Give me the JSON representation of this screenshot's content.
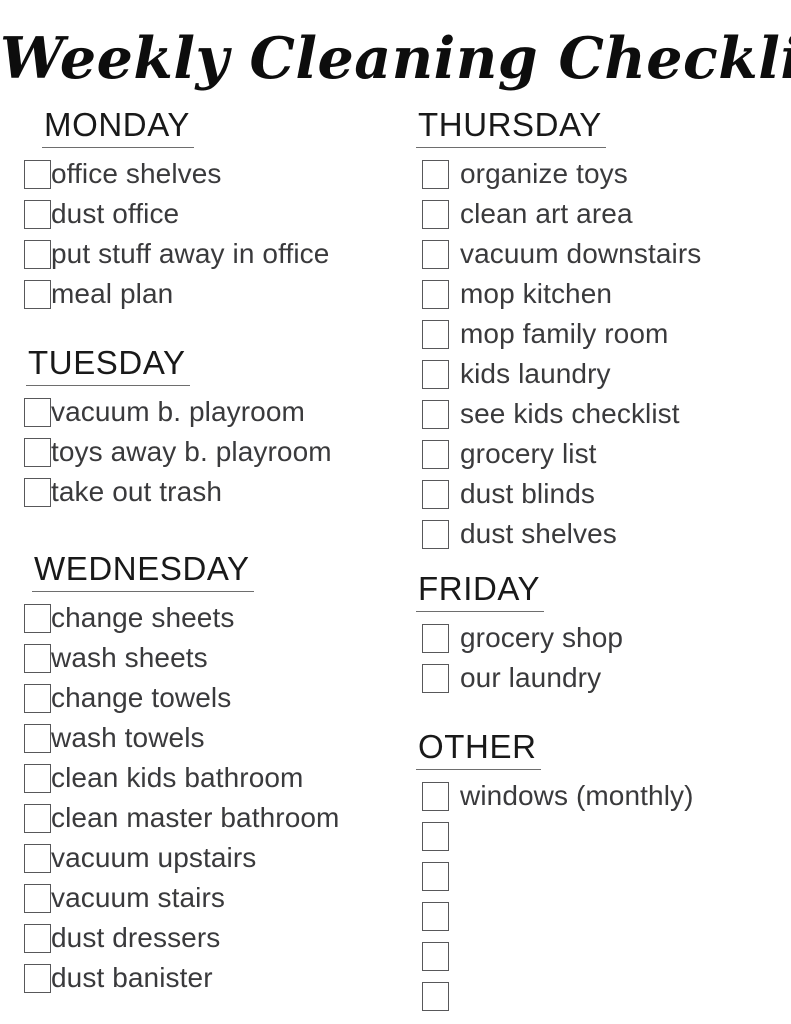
{
  "document": {
    "title": "Weekly Cleaning Checklist"
  },
  "colors": {
    "text": "#3a3a3c",
    "heading": "#191919",
    "title": "#0d0d0d",
    "checkbox_border": "#58585a",
    "underline": "#6e6e6e",
    "background": "#ffffff"
  },
  "columns": {
    "left": [
      {
        "id": "monday",
        "heading": "MONDAY",
        "items": [
          {
            "label": "office shelves",
            "checked": false
          },
          {
            "label": "dust office",
            "checked": false
          },
          {
            "label": "put stuff away in office",
            "checked": false
          },
          {
            "label": "meal plan",
            "checked": false
          }
        ]
      },
      {
        "id": "tuesday",
        "heading": "TUESDAY",
        "items": [
          {
            "label": "vacuum b. playroom",
            "checked": false
          },
          {
            "label": "toys away b. playroom",
            "checked": false
          },
          {
            "label": "take out trash",
            "checked": false
          }
        ]
      },
      {
        "id": "wednesday",
        "heading": "WEDNESDAY",
        "items": [
          {
            "label": "change sheets",
            "checked": false
          },
          {
            "label": "wash sheets",
            "checked": false
          },
          {
            "label": "change towels",
            "checked": false
          },
          {
            "label": "wash towels",
            "checked": false
          },
          {
            "label": "clean kids bathroom",
            "checked": false
          },
          {
            "label": "clean master bathroom",
            "checked": false
          },
          {
            "label": "vacuum upstairs",
            "checked": false
          },
          {
            "label": "vacuum stairs",
            "checked": false
          },
          {
            "label": "dust dressers",
            "checked": false
          },
          {
            "label": "dust banister",
            "checked": false
          }
        ]
      }
    ],
    "right": [
      {
        "id": "thursday",
        "heading": "THURSDAY",
        "items": [
          {
            "label": "organize toys",
            "checked": false
          },
          {
            "label": "clean art area",
            "checked": false
          },
          {
            "label": "vacuum downstairs",
            "checked": false
          },
          {
            "label": "mop kitchen",
            "checked": false
          },
          {
            "label": "mop family room",
            "checked": false
          },
          {
            "label": "kids laundry",
            "checked": false
          },
          {
            "label": "see kids checklist",
            "checked": false
          },
          {
            "label": "grocery list",
            "checked": false
          },
          {
            "label": "dust blinds",
            "checked": false
          },
          {
            "label": "dust shelves",
            "checked": false
          }
        ]
      },
      {
        "id": "friday",
        "heading": "FRIDAY",
        "items": [
          {
            "label": "grocery shop",
            "checked": false
          },
          {
            "label": "our laundry",
            "checked": false
          }
        ]
      },
      {
        "id": "other",
        "heading": "OTHER",
        "items": [
          {
            "label": "windows (monthly)",
            "checked": false
          },
          {
            "label": "",
            "checked": false
          },
          {
            "label": "",
            "checked": false
          },
          {
            "label": "",
            "checked": false
          },
          {
            "label": "",
            "checked": false
          },
          {
            "label": "",
            "checked": false
          }
        ]
      }
    ]
  }
}
